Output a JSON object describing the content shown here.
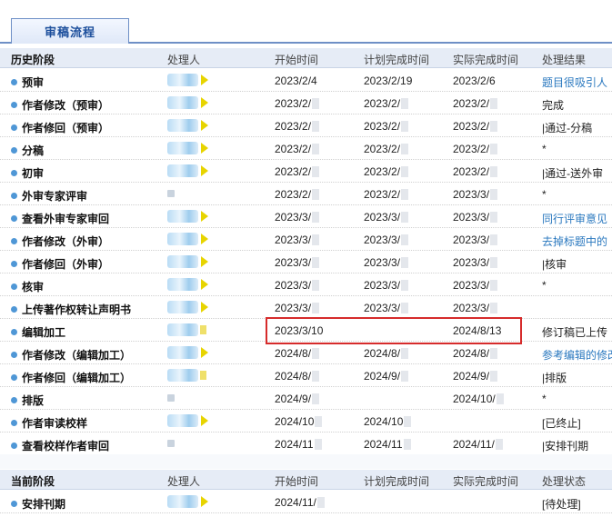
{
  "tab": {
    "label": "审稿流程"
  },
  "history_header": {
    "stage": "历史阶段",
    "handler": "处理人",
    "start": "开始时间",
    "plan": "计划完成时间",
    "actual": "实际完成时间",
    "result": "处理结果"
  },
  "history_rows": [
    {
      "stage": "预审",
      "start": "2023/2/4",
      "plan": "2023/2/19",
      "actual": "2023/2/6",
      "result": "题目很吸引人",
      "result_link": true,
      "handler_mark": "arrow"
    },
    {
      "stage": "作者修改（预审）",
      "start": "2023/2/",
      "plan": "2023/2/",
      "actual": "2023/2/",
      "result": "完成",
      "result_link": false,
      "handler_mark": "arrow"
    },
    {
      "stage": "作者修回（预审）",
      "start": "2023/2/",
      "plan": "2023/2/",
      "actual": "2023/2/",
      "result": "|通过-分稿",
      "result_link": false,
      "handler_mark": "arrow"
    },
    {
      "stage": "分稿",
      "start": "2023/2/",
      "plan": "2023/2/",
      "actual": "2023/2/",
      "result": "*",
      "result_link": false,
      "handler_mark": "arrow"
    },
    {
      "stage": "初审",
      "start": "2023/2/",
      "plan": "2023/2/",
      "actual": "2023/2/",
      "result": "|通过-送外审",
      "result_link": false,
      "handler_mark": "arrow"
    },
    {
      "stage": "外审专家评审",
      "start": "2023/2/",
      "plan": "2023/2/",
      "actual": "2023/3/",
      "result": "*",
      "result_link": false,
      "handler_mark": "none"
    },
    {
      "stage": "查看外审专家审回",
      "start": "2023/3/",
      "plan": "2023/3/",
      "actual": "2023/3/",
      "result": "同行评审意见",
      "result_link": true,
      "handler_mark": "arrow"
    },
    {
      "stage": "作者修改（外审）",
      "start": "2023/3/",
      "plan": "2023/3/",
      "actual": "2023/3/",
      "result": "去掉标题中的",
      "result_link": true,
      "handler_mark": "arrow"
    },
    {
      "stage": "作者修回（外审）",
      "start": "2023/3/",
      "plan": "2023/3/",
      "actual": "2023/3/",
      "result": "|核审",
      "result_link": false,
      "handler_mark": "arrow"
    },
    {
      "stage": "核审",
      "start": "2023/3/",
      "plan": "2023/3/",
      "actual": "2023/3/",
      "result": "*",
      "result_link": false,
      "handler_mark": "arrow"
    },
    {
      "stage": "上传著作权转让声明书",
      "start": "2023/3/",
      "plan": "2023/3/",
      "actual": "2023/3/",
      "result": "",
      "result_link": false,
      "handler_mark": "arrow"
    },
    {
      "stage": "编辑加工",
      "start": "2023/3/10",
      "plan": "",
      "actual": "2024/8/13",
      "result": "修订稿已上传",
      "result_link": false,
      "handler_mark": "square"
    },
    {
      "stage": "作者修改（编辑加工）",
      "start": "2024/8/",
      "plan": "2024/8/",
      "actual": "2024/8/",
      "result": "参考编辑的修改",
      "result_link": true,
      "handler_mark": "arrow"
    },
    {
      "stage": "作者修回（编辑加工）",
      "start": "2024/8/",
      "plan": "2024/9/",
      "actual": "2024/9/",
      "result": "|排版",
      "result_link": false,
      "handler_mark": "square"
    },
    {
      "stage": "排版",
      "start": "2024/9/",
      "plan": "",
      "actual": "2024/10/",
      "result": "*",
      "result_link": false,
      "handler_mark": "none"
    },
    {
      "stage": "作者审读校样",
      "start": "2024/10",
      "plan": "2024/10",
      "actual": "",
      "result": "[已终止]",
      "result_link": false,
      "handler_mark": "arrow"
    },
    {
      "stage": "查看校样作者审回",
      "start": "2024/11",
      "plan": "2024/11",
      "actual": "2024/11/",
      "result": "|安排刊期",
      "result_link": false,
      "handler_mark": "none"
    }
  ],
  "current_header": {
    "stage": "当前阶段",
    "handler": "处理人",
    "start": "开始时间",
    "plan": "计划完成时间",
    "actual": "实际完成时间",
    "result": "处理状态"
  },
  "current_rows": [
    {
      "stage": "安排刊期",
      "start": "2024/11/",
      "plan": "",
      "actual": "",
      "result": "[待处理]",
      "result_link": false,
      "handler_mark": "arrow"
    }
  ],
  "colors": {
    "accent": "#2a78bf",
    "highlight": "#d62b2b",
    "header_bg": "#e6ecf6",
    "marker": "#e7d400"
  }
}
